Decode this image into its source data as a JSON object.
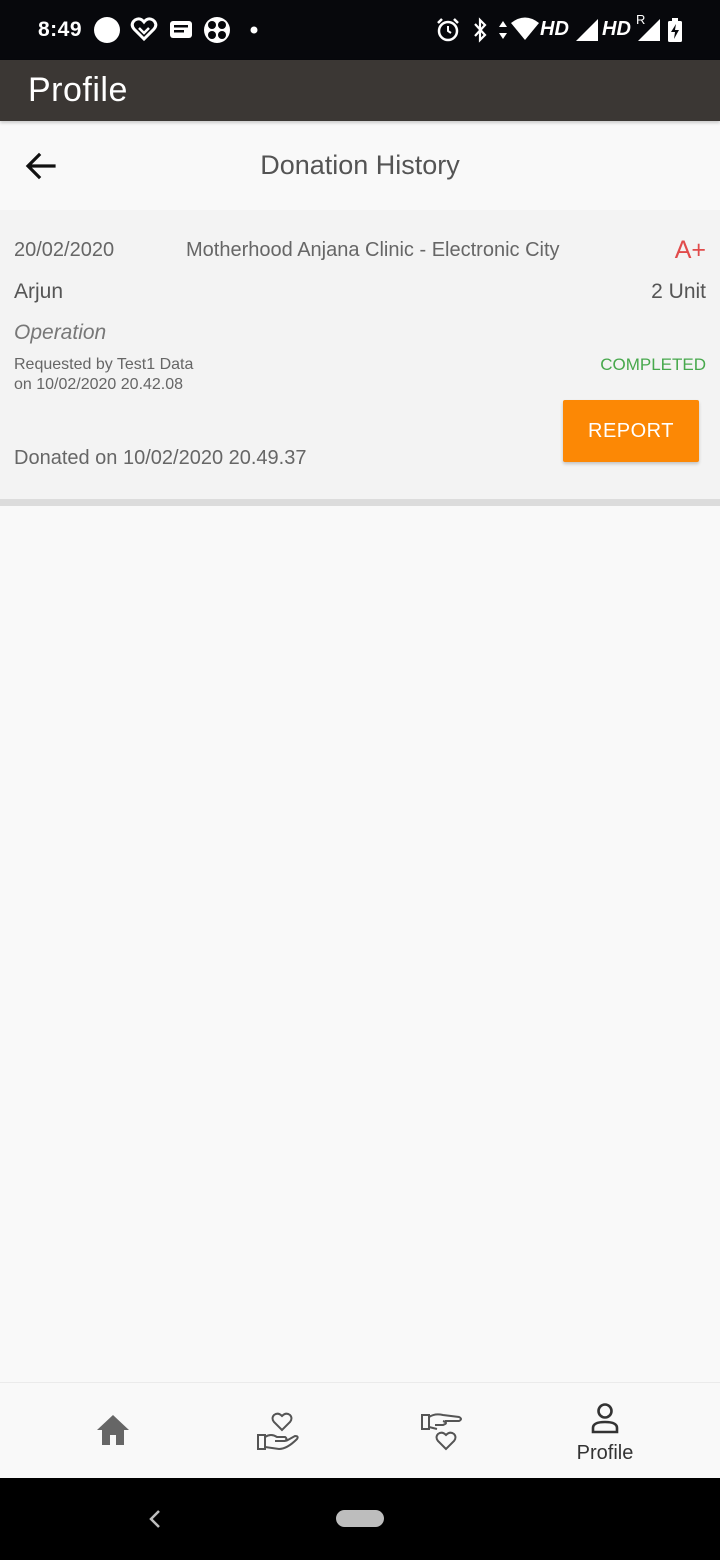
{
  "status_bar": {
    "time": "8:49",
    "network_labels": [
      "HD",
      "HD"
    ],
    "roaming": "R",
    "icons": [
      "circle-icon",
      "heart-badge-icon",
      "message-icon",
      "fan-icon",
      "dot-icon",
      "alarm-icon",
      "bluetooth-icon",
      "data-arrows-icon",
      "wifi-icon",
      "signal-icon",
      "signal-icon",
      "battery-charging-icon"
    ]
  },
  "app_bar": {
    "title": "Profile"
  },
  "header": {
    "back_icon": "arrow-left-icon",
    "title": "Donation History"
  },
  "donation": {
    "date": "20/02/2020",
    "clinic": "Motherhood Anjana Clinic - Electronic City",
    "blood_group": "A+",
    "name": "Arjun",
    "units": "2 Unit",
    "reason": "Operation",
    "requested_by": "Requested by Test1 Data",
    "requested_on": "on 10/02/2020 20.42.08",
    "status": "COMPLETED",
    "report_label": "REPORT",
    "donated_on": "Donated on 10/02/2020 20.49.37"
  },
  "bottom_nav": {
    "items": [
      {
        "icon": "home-icon",
        "label": ""
      },
      {
        "icon": "heart-hand-icon",
        "label": ""
      },
      {
        "icon": "hand-heart-icon",
        "label": ""
      },
      {
        "icon": "person-icon",
        "label": "Profile"
      }
    ]
  },
  "colors": {
    "status_bar": "#07080c",
    "app_bar": "#3b3734",
    "accent_orange": "#fc8805",
    "completed_green": "#47a84c",
    "blood_red": "#e14b4b"
  }
}
